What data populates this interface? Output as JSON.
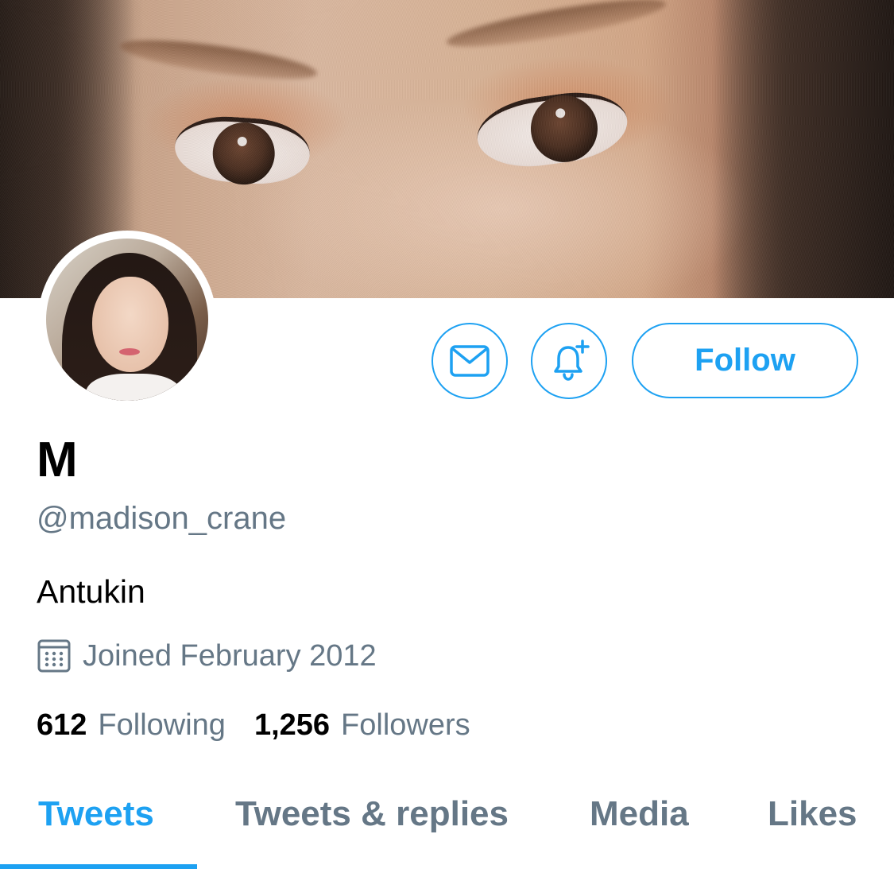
{
  "profile": {
    "display_name": "M",
    "handle": "@madison_crane",
    "bio": "Antukin",
    "joined": "Joined February 2012"
  },
  "stats": {
    "following_count": "612",
    "following_label": "Following",
    "followers_count": "1,256",
    "followers_label": "Followers"
  },
  "actions": {
    "follow_label": "Follow",
    "message_icon": "envelope-icon",
    "notify_icon": "bell-plus-icon"
  },
  "tabs": [
    {
      "label": "Tweets",
      "active": true
    },
    {
      "label": "Tweets & replies",
      "active": false
    },
    {
      "label": "Media",
      "active": false
    },
    {
      "label": "Likes",
      "active": false
    }
  ],
  "icons": {
    "joined_icon": "calendar-icon"
  },
  "colors": {
    "accent": "#1da1f2",
    "secondary_text": "#657786",
    "primary_text": "#000000"
  }
}
